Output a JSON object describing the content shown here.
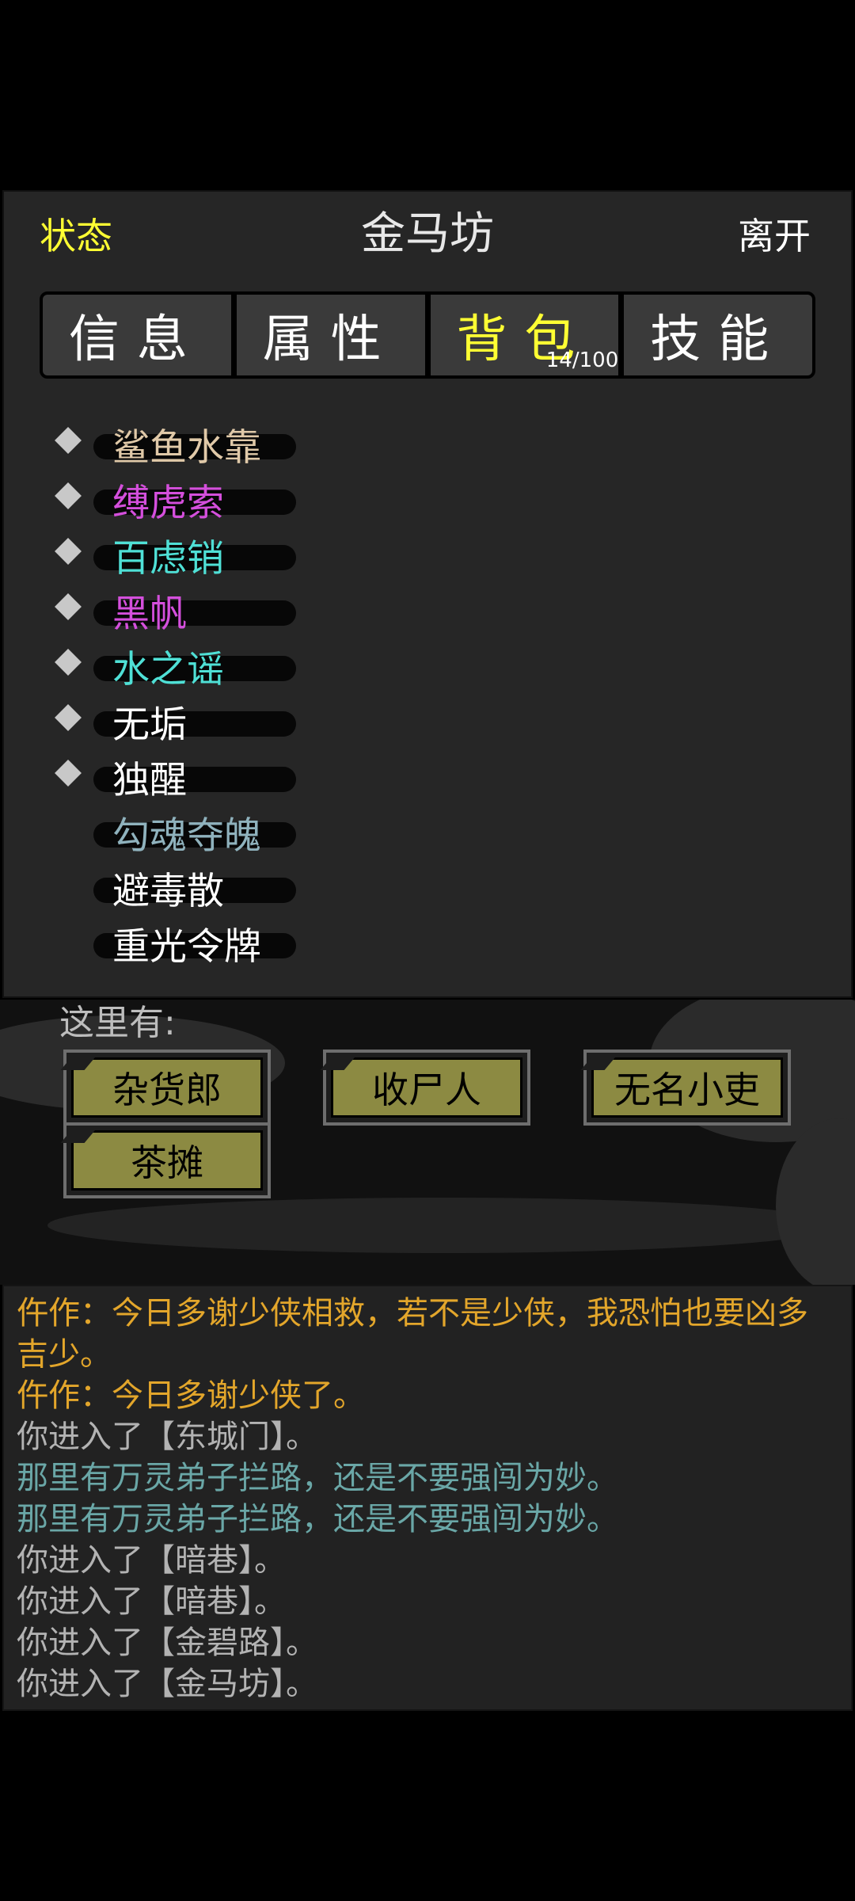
{
  "header": {
    "status_label": "状态",
    "location": "金马坊",
    "leave_label": "离开"
  },
  "tabs": [
    {
      "label": "信息",
      "active": false
    },
    {
      "label": "属性",
      "active": false
    },
    {
      "label": "背包",
      "active": true
    },
    {
      "label": "技能",
      "active": false
    }
  ],
  "bag": {
    "count": "14/100",
    "items": [
      {
        "name": "鲨鱼水靠",
        "color": "#e0c9a8",
        "marked": true
      },
      {
        "name": "缚虎索",
        "color": "#d44fdc",
        "marked": true
      },
      {
        "name": "百虑销",
        "color": "#4fe0d6",
        "marked": true
      },
      {
        "name": "黑帆",
        "color": "#d44fdc",
        "marked": true
      },
      {
        "name": "水之谣",
        "color": "#4fe0d6",
        "marked": true
      },
      {
        "name": "无垢",
        "color": "#ffffff",
        "marked": true
      },
      {
        "name": "独醒",
        "color": "#ffffff",
        "marked": true
      },
      {
        "name": "勾魂夺魄",
        "color": "#8fb2bd",
        "marked": false
      },
      {
        "name": "避毒散",
        "color": "#ffffff",
        "marked": false
      },
      {
        "name": "重光令牌",
        "color": "#ffffff",
        "marked": false
      }
    ]
  },
  "npc_area": {
    "label": "这里有:",
    "npcs": [
      "杂货郎",
      "收尸人",
      "无名小吏",
      "茶摊"
    ]
  },
  "log": [
    {
      "text": "仵作：今日多谢少侠相救，若不是少侠，我恐怕也要凶多吉少。",
      "type": "orange"
    },
    {
      "text": "仵作：今日多谢少侠了。",
      "type": "orange"
    },
    {
      "text": "你进入了【东城门】。",
      "type": "gray"
    },
    {
      "text": "那里有万灵弟子拦路，还是不要强闯为妙。",
      "type": "teal"
    },
    {
      "text": "那里有万灵弟子拦路，还是不要强闯为妙。",
      "type": "teal"
    },
    {
      "text": "你进入了【暗巷】。",
      "type": "gray"
    },
    {
      "text": "你进入了【暗巷】。",
      "type": "gray"
    },
    {
      "text": "你进入了【金碧路】。",
      "type": "gray"
    },
    {
      "text": "你进入了【金马坊】。",
      "type": "gray"
    }
  ],
  "colors": {
    "accent_yellow": "#ffff33",
    "npc_button": "#8c8a42",
    "log_orange": "#e3a62b",
    "log_teal": "#6aa7a7"
  }
}
